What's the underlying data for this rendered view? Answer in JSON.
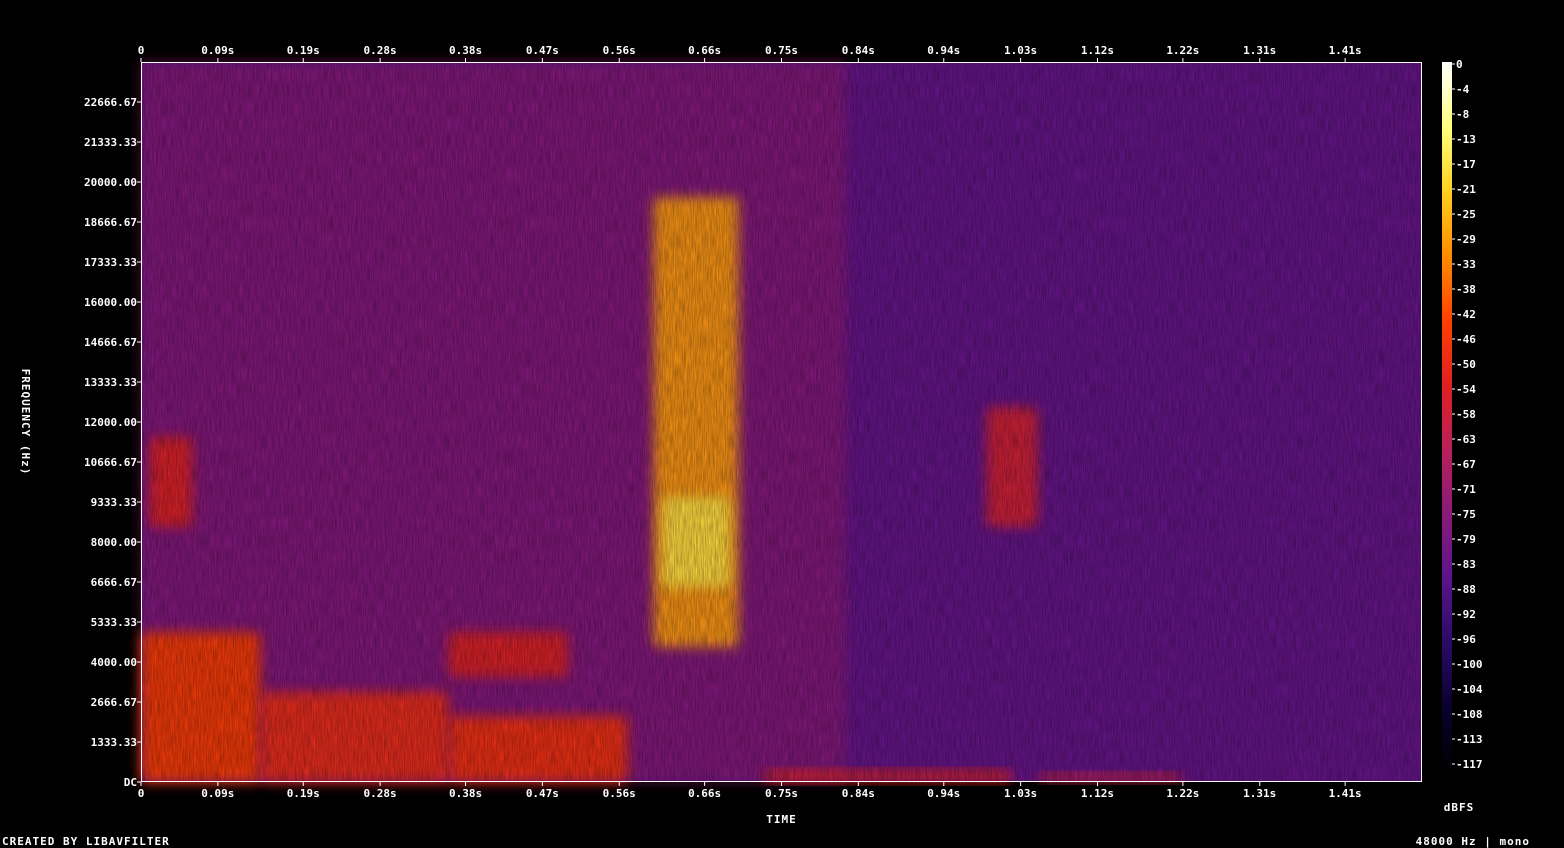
{
  "chart_data": {
    "type": "heatmap",
    "title": "",
    "xlabel": "TIME",
    "ylabel": "FREQUENCY (Hz)",
    "colorbar_label": "dBFS",
    "footer_left": "CREATED BY LIBAVFILTER",
    "footer_right": "48000 Hz | mono",
    "x_ticks": [
      "0",
      "0.09s",
      "0.19s",
      "0.28s",
      "0.38s",
      "0.47s",
      "0.56s",
      "0.66s",
      "0.75s",
      "0.84s",
      "0.94s",
      "1.03s",
      "1.12s",
      "1.22s",
      "1.31s",
      "1.41s"
    ],
    "x_tick_values": [
      0,
      0.09,
      0.19,
      0.28,
      0.38,
      0.47,
      0.56,
      0.66,
      0.75,
      0.84,
      0.94,
      1.03,
      1.12,
      1.22,
      1.31,
      1.41
    ],
    "xlim": [
      0,
      1.5
    ],
    "y_ticks": [
      "DC",
      "1333.33",
      "2666.67",
      "4000.00",
      "5333.33",
      "6666.67",
      "8000.00",
      "9333.33",
      "10666.67",
      "12000.00",
      "13333.33",
      "14666.67",
      "16000.00",
      "17333.33",
      "18666.67",
      "20000.00",
      "21333.33",
      "22666.67"
    ],
    "y_tick_values": [
      0,
      1333.33,
      2666.67,
      4000,
      5333.33,
      6666.67,
      8000,
      9333.33,
      10666.67,
      12000,
      13333.33,
      14666.67,
      16000,
      17333.33,
      18666.67,
      20000,
      21333.33,
      22666.67
    ],
    "ylim": [
      0,
      24000
    ],
    "colorbar_ticks": [
      "0",
      "-4",
      "-8",
      "-13",
      "-17",
      "-21",
      "-25",
      "-29",
      "-33",
      "-38",
      "-42",
      "-46",
      "-50",
      "-54",
      "-58",
      "-63",
      "-67",
      "-71",
      "-75",
      "-79",
      "-83",
      "-88",
      "-92",
      "-96",
      "-100",
      "-104",
      "-108",
      "-113",
      "-117"
    ],
    "colorbar_range": [
      -120,
      0
    ],
    "colormap": [
      "#000000",
      "#0a0030",
      "#2a0a66",
      "#5a148a",
      "#8a1a7a",
      "#b8205a",
      "#e02020",
      "#ff4000",
      "#ff8c00",
      "#ffd020",
      "#ffff80",
      "#ffffff"
    ],
    "background_level_db": -85,
    "energy_regions": [
      {
        "name": "onset low harmonics",
        "t": [
          0.0,
          0.14
        ],
        "f": [
          0,
          5000
        ],
        "db": -45
      },
      {
        "name": "onset mid band",
        "t": [
          0.01,
          0.06
        ],
        "f": [
          8500,
          11500
        ],
        "db": -55
      },
      {
        "name": "low harmonics",
        "t": [
          0.14,
          0.36
        ],
        "f": [
          0,
          3000
        ],
        "db": -50
      },
      {
        "name": "low harmonics",
        "t": [
          0.36,
          0.57
        ],
        "f": [
          0,
          2200
        ],
        "db": -48
      },
      {
        "name": "mid cluster",
        "t": [
          0.36,
          0.5
        ],
        "f": [
          3500,
          5000
        ],
        "db": -55
      },
      {
        "name": "fricative burst",
        "t": [
          0.6,
          0.7
        ],
        "f": [
          4500,
          19500
        ],
        "db": -30
      },
      {
        "name": "fricative peak",
        "t": [
          0.61,
          0.69
        ],
        "f": [
          6500,
          9500
        ],
        "db": -18
      },
      {
        "name": "low tail",
        "t": [
          0.73,
          1.02
        ],
        "f": [
          0,
          400
        ],
        "db": -55
      },
      {
        "name": "upper band",
        "t": [
          0.99,
          1.05
        ],
        "f": [
          8500,
          12500
        ],
        "db": -58
      },
      {
        "name": "low tail",
        "t": [
          1.05,
          1.22
        ],
        "f": [
          0,
          300
        ],
        "db": -60
      }
    ]
  }
}
